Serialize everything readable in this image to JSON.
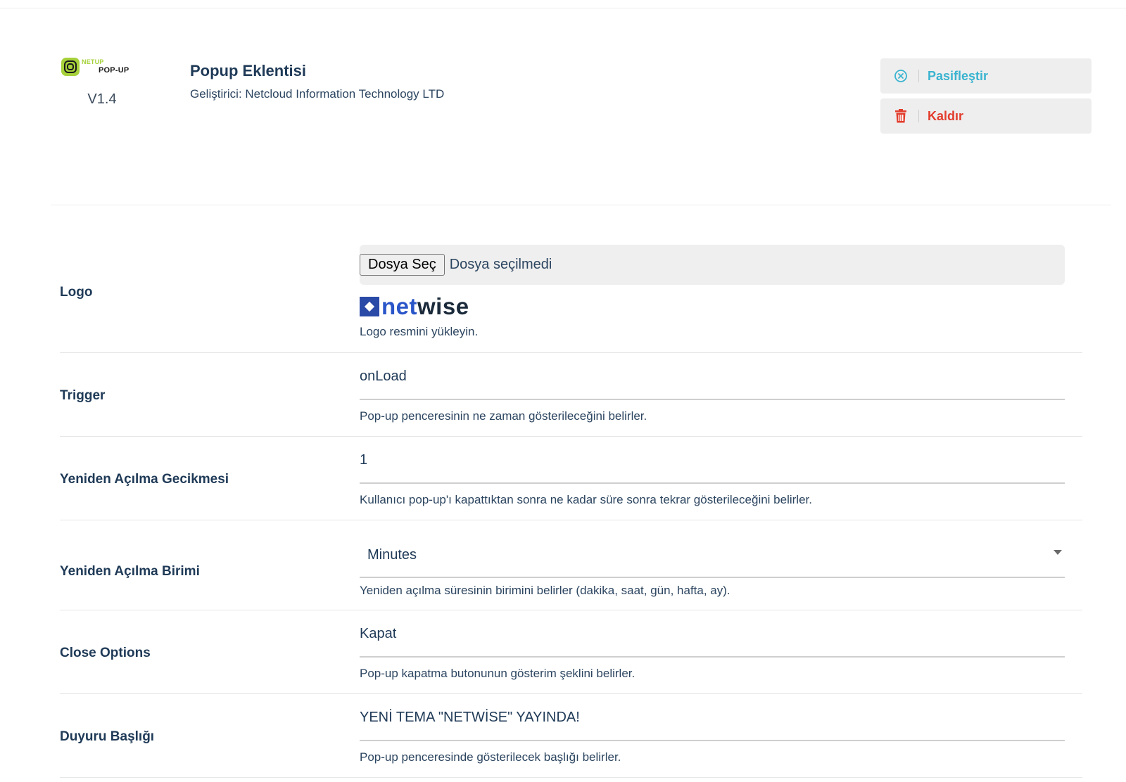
{
  "plugin": {
    "logo_text_top": "NETUP",
    "logo_text_bottom": "POP-UP",
    "version": "V1.4",
    "title": "Popup Eklentisi",
    "developer": "Geliştirici: Netcloud Information Technology LTD",
    "actions": {
      "deactivate_label": "Pasifleştir",
      "deactivate_icon": "circle-x-icon",
      "remove_label": "Kaldır",
      "remove_icon": "trash-icon"
    }
  },
  "colors": {
    "accent": "#3ab4d0",
    "danger": "#e23d2d",
    "brand_green": "#a6d13a",
    "label": "#1f3a57",
    "netwise_blue": "#2a55c9"
  },
  "settings": {
    "logo": {
      "label": "Logo",
      "file_button": "Dosya Seç",
      "file_status": "Dosya seçilmedi",
      "preview_text_a": "net",
      "preview_text_b": "wise",
      "help": "Logo resmini yükleyin."
    },
    "trigger": {
      "label": "Trigger",
      "value": "onLoad",
      "help": "Pop-up penceresinin ne zaman gösterileceğini belirler."
    },
    "reopen_delay": {
      "label": "Yeniden Açılma Gecikmesi",
      "value": "1",
      "help": "Kullanıcı pop-up'ı kapattıktan sonra ne kadar süre sonra tekrar gösterileceğini belirler."
    },
    "reopen_unit": {
      "label": "Yeniden Açılma Birimi",
      "value": "Minutes",
      "help": "Yeniden açılma süresinin birimini belirler (dakika, saat, gün, hafta, ay)."
    },
    "close_options": {
      "label": "Close Options",
      "value": "Kapat",
      "help": "Pop-up kapatma butonunun gösterim şeklini belirler."
    },
    "announcement_title": {
      "label": "Duyuru Başlığı",
      "value": "YENİ TEMA \"NETWİSE\" YAYINDA!",
      "help": "Pop-up penceresinde gösterilecek başlığı belirler."
    }
  }
}
